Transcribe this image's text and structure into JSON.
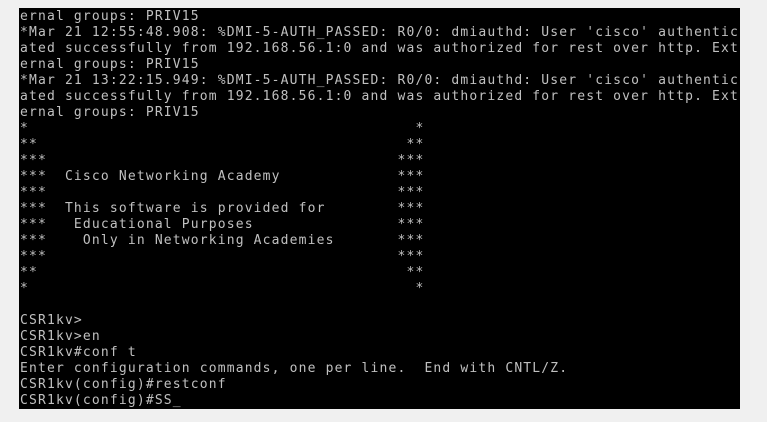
{
  "console": {
    "lines": [
      "ernal groups: PRIV15",
      "*Mar 21 12:55:48.908: %DMI-5-AUTH_PASSED: R0/0: dmiauthd: User 'cisco' authentic",
      "ated successfully from 192.168.56.1:0 and was authorized for rest over http. Ext",
      "ernal groups: PRIV15",
      "*Mar 21 13:22:15.949: %DMI-5-AUTH_PASSED: R0/0: dmiauthd: User 'cisco' authentic",
      "ated successfully from 192.168.56.1:0 and was authorized for rest over http. Ext",
      "ernal groups: PRIV15",
      "*                                           *",
      "**                                         **",
      "***                                       ***",
      "***  Cisco Networking Academy             ***",
      "***                                       ***",
      "***  This software is provided for        ***",
      "***   Educational Purposes                ***",
      "***    Only in Networking Academies       ***",
      "***                                       ***",
      "**                                         **",
      "*                                           *",
      "",
      "CSR1kv>",
      "CSR1kv>en",
      "CSR1kv#conf t",
      "Enter configuration commands, one per line.  End with CNTL/Z.",
      "CSR1kv(config)#restconf",
      "CSR1kv(config)#SS"
    ],
    "cursor": "_"
  }
}
